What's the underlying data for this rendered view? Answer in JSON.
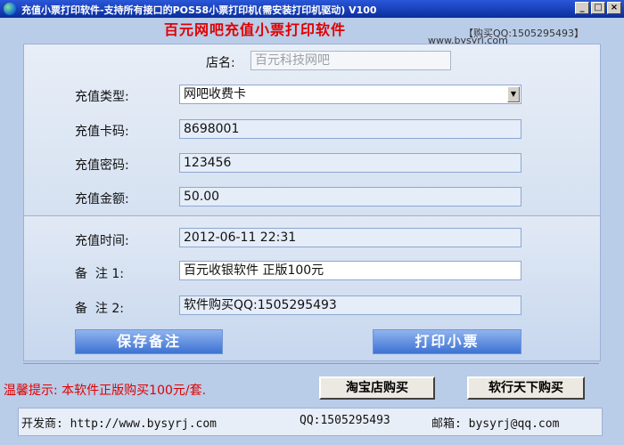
{
  "window": {
    "title": "充值小票打印软件-支持所有接口的POS58小票打印机(需安装打印机驱动)   V100",
    "min_label": "_",
    "max_label": "□",
    "close_label": "×"
  },
  "header": {
    "banner": "百元网吧充值小票打印软件",
    "buy_qq": "【购买QQ:1505295493】",
    "site_url": "www.bysyrj.com"
  },
  "form": {
    "shop_label": "店名:",
    "shop_value": "百元科技网吧",
    "type_label": "充值类型:",
    "type_value": "网吧收费卡",
    "card_label": "充值卡码:",
    "card_value": "8698001",
    "pwd_label": "充值密码:",
    "pwd_value": "123456",
    "amount_label": "充值金额:",
    "amount_value": "50.00",
    "time_label": "充值时间:",
    "time_value": "2012-06-11 22:31",
    "note1_label": "备  注 1:",
    "note1_value": "百元收银软件 正版100元",
    "note2_label": "备  注 2:",
    "note2_value": "软件购买QQ:1505295493"
  },
  "buttons": {
    "save_note": "保存备注",
    "print_ticket": "打印小票",
    "taobao_buy": "淘宝店购买",
    "rxts_buy": "软行天下购买"
  },
  "tip": "温馨提示: 本软件正版购买100元/套.",
  "footer": {
    "developer": "开发商: http://www.bysyrj.com",
    "qq": "QQ:1505295493",
    "email": "邮箱: bysyrj@qq.com"
  }
}
